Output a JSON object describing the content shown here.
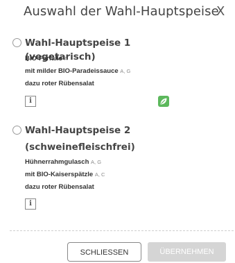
{
  "dialog": {
    "title": "Auswahl der Wahl-Hauptspeise",
    "close_icon_text": "X"
  },
  "options": [
    {
      "title": "Wahl-Hauptspeise 1 (vegetarisch)",
      "lines": [
        {
          "text": "BIO-Farfalle",
          "allergens": "A"
        },
        {
          "text": "mit milder BIO-Paradeissauce",
          "allergens": "A, G"
        },
        {
          "text": "dazu roter Rübensalat",
          "allergens": ""
        }
      ],
      "info_label": "i",
      "badge_icon": "leaf-icon",
      "badge_color": "#5cb85c"
    },
    {
      "title_line1": "Wahl-Hauptspeise 2",
      "title_line2": "(schweinefleischfrei)",
      "lines": [
        {
          "text": "Hühnerrahmgulasch",
          "allergens": "A, G"
        },
        {
          "text": "mit BIO-Kaiserspätzle",
          "allergens": "A, C"
        },
        {
          "text": "dazu roter Rübensalat",
          "allergens": ""
        }
      ],
      "info_label": "i"
    }
  ],
  "buttons": {
    "close_label": "SCHLIESSEN",
    "accept_label": "ÜBERNEHMEN"
  }
}
